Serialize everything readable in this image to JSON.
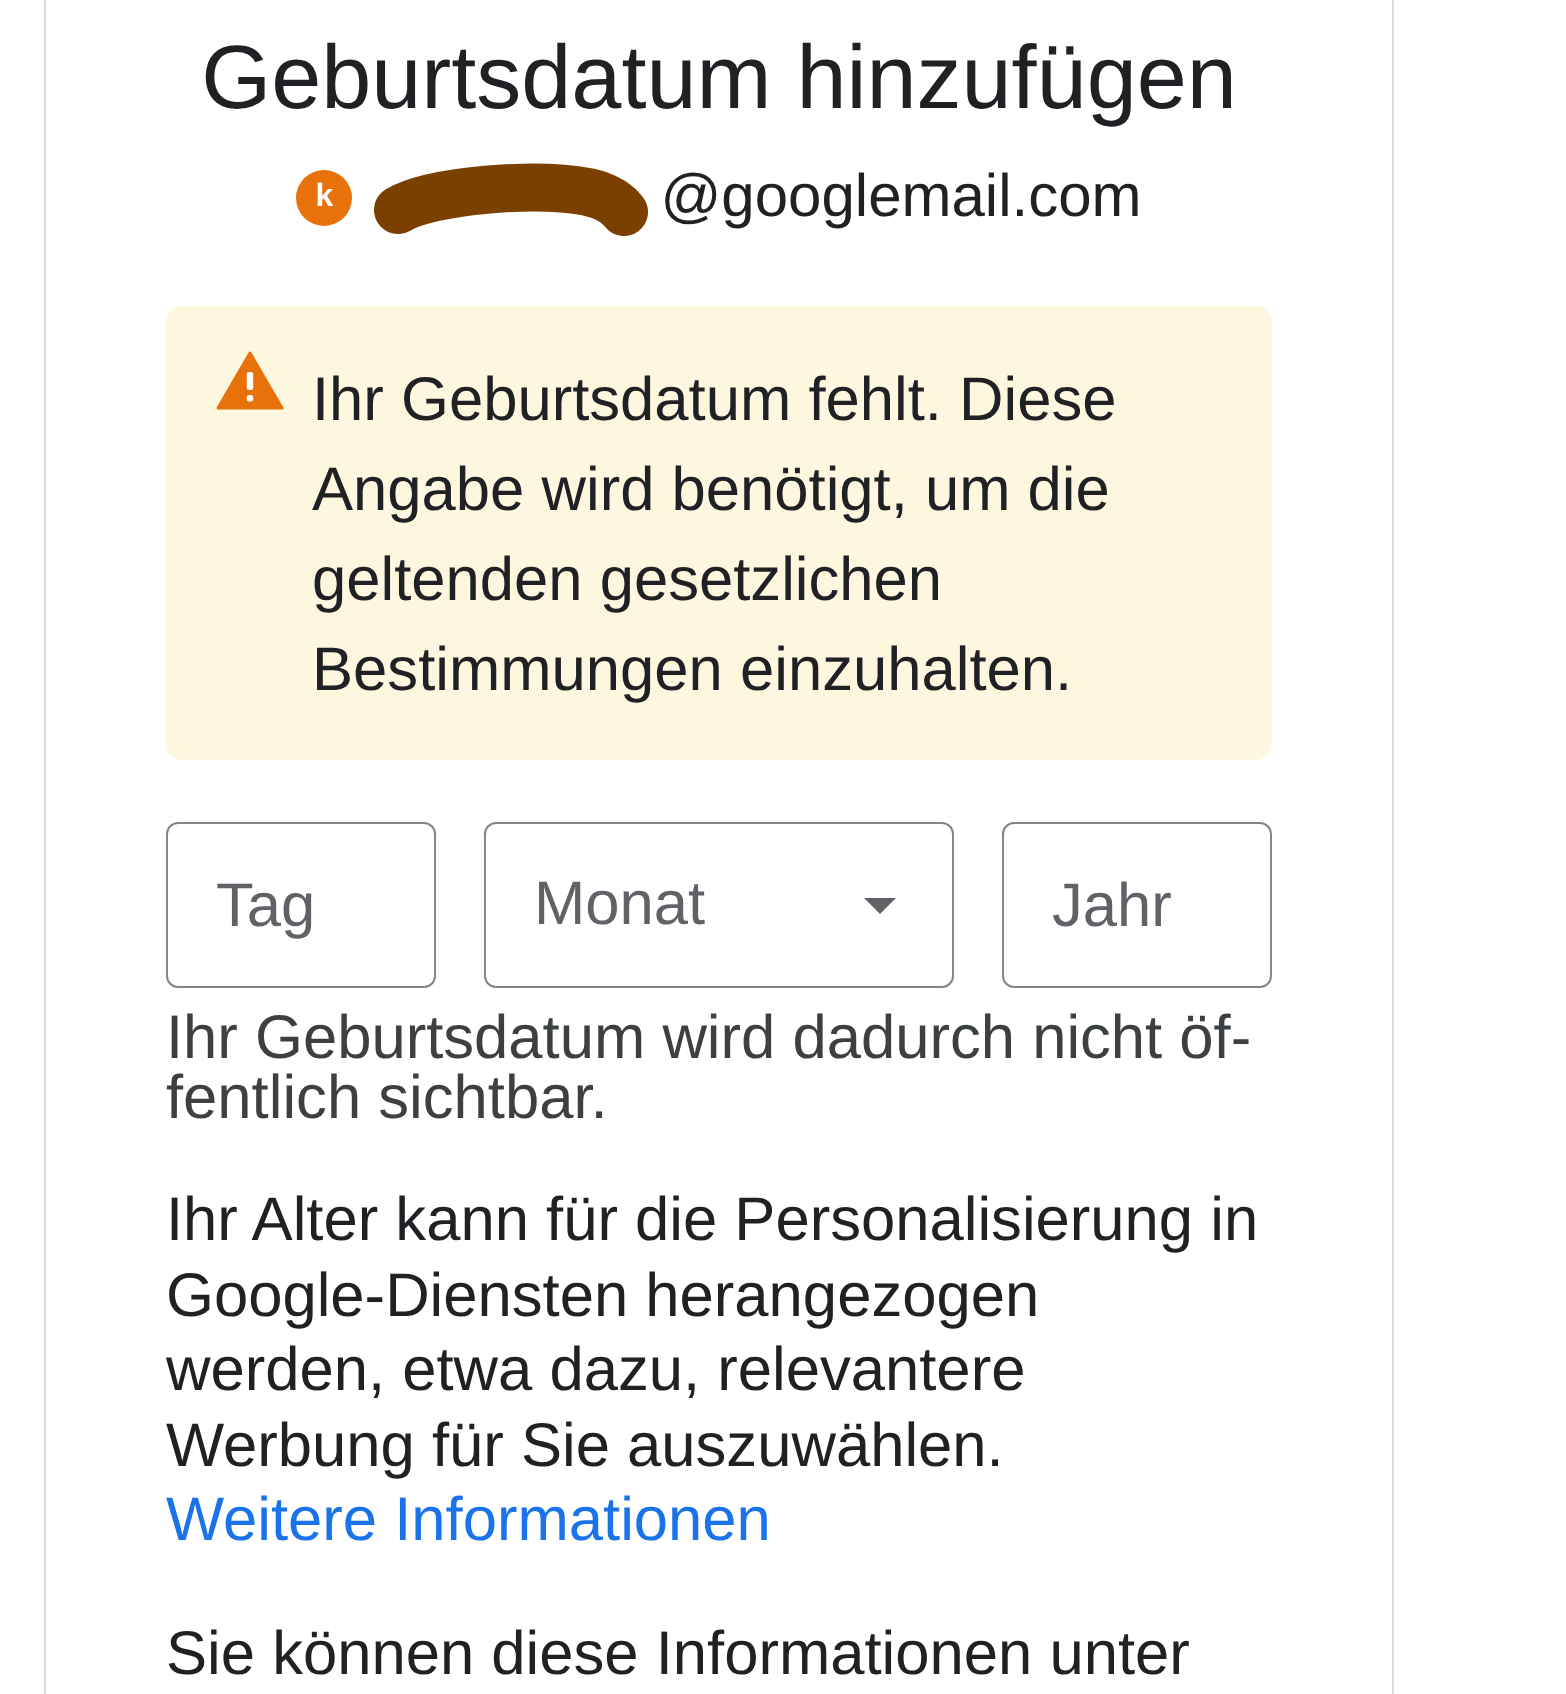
{
  "title": "Geburtsdatum hinzufügen",
  "account": {
    "avatar_letter": "k",
    "email": "@googlemail.com",
    "redacted": true
  },
  "alert": {
    "kind": "warning",
    "text": "Ihr Geburtsdatum fehlt. Diese Angabe wird benötigt, um die geltenden gesetzlichen Bestimmungen einzuhalten."
  },
  "birthday_fields": [
    {
      "kind": "text",
      "placeholder": "Tag"
    },
    {
      "kind": "dropdown",
      "placeholder": "Monat"
    },
    {
      "kind": "text",
      "placeholder": "Jahr"
    }
  ],
  "helper_text": "Ihr Geburtsdatum wird dadurch nicht öf-fentlich sichtbar.",
  "paragraphs": [
    {
      "text": "Ihr Alter kann für die Personalisierung in Google-Diensten herangezogen werden, etwa dazu, relevantere Werbung für Sie auszuwählen.",
      "link": "Weitere Informationen"
    },
    {
      "text": "Sie können diese Informationen unter"
    }
  ]
}
